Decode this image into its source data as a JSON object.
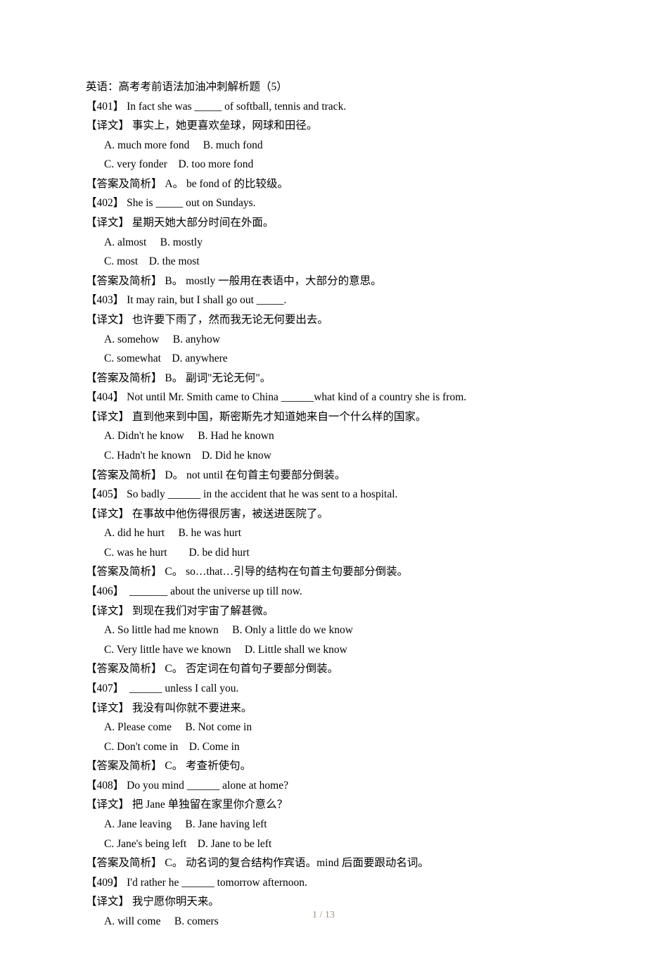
{
  "title": "英语：高考考前语法加油冲刺解析题（5）",
  "footer": "1 / 13",
  "questions": [
    {
      "num": "【401】",
      "stem": " In fact she was _____ of softball, tennis and track.",
      "trans": "【译文】 事实上，她更喜欢垒球，网球和田径。",
      "opts": [
        "A. much more fond     B. much fond",
        "C. very fonder    D. too more fond"
      ],
      "ans": "【答案及简析】 A。 be fond of 的比较级。"
    },
    {
      "num": "【402】",
      "stem": " She is _____ out on Sundays.",
      "trans": "【译文】 星期天她大部分时间在外面。",
      "opts": [
        "A. almost     B. mostly",
        "C. most    D. the most"
      ],
      "ans": "【答案及简析】 B。 mostly 一般用在表语中，大部分的意思。"
    },
    {
      "num": "【403】",
      "stem": " It may rain, but I shall go out _____.",
      "trans": "【译文】 也许要下雨了，然而我无论无何要出去。",
      "opts": [
        "A. somehow     B. anyhow",
        "C. somewhat    D. anywhere"
      ],
      "ans": "【答案及简析】 B。 副词\"无论无何\"。"
    },
    {
      "num": "【404】",
      "stem": " Not until Mr. Smith came to China ______what kind of a country she is from.",
      "trans": "【译文】 直到他来到中国，斯密斯先才知道她来自一个什么样的国家。",
      "opts": [
        "A. Didn't he know     B. Had he known",
        "C. Hadn't he known    D. Did he know"
      ],
      "ans": "【答案及简析】 D。 not until 在句首主句要部分倒装。"
    },
    {
      "num": "【405】",
      "stem": " So badly ______ in the accident that he was sent to a hospital.",
      "trans": "【译文】 在事故中他伤得很厉害，被送进医院了。",
      "opts": [
        "A. did he hurt     B. he was hurt",
        "C. was he hurt        D. be did hurt"
      ],
      "ans": "【答案及简析】 C。 so…that…引导的结构在句首主句要部分倒装。"
    },
    {
      "num": "【406】",
      "stem": "  _______ about the universe up till now.",
      "trans": "【译文】 到现在我们对宇宙了解甚微。",
      "opts": [
        "A. So little had me known     B. Only a little do we know",
        "C. Very little have we known     D. Little shall we know"
      ],
      "ans": "【答案及简析】 C。 否定词在句首句子要部分倒装。"
    },
    {
      "num": "【407】",
      "stem": "  ______ unless I call you.",
      "trans": "【译文】 我没有叫你就不要进来。",
      "opts": [
        "A. Please come     B. Not come in",
        "C. Don't come in    D. Come in"
      ],
      "ans": "【答案及简析】 C。 考查祈使句。"
    },
    {
      "num": "【408】",
      "stem": " Do you mind ______ alone at home?",
      "trans": "【译文】 把 Jane 单独留在家里你介意么？",
      "opts": [
        "A. Jane leaving     B. Jane having left",
        "C. Jane's being left    D. Jane to be left"
      ],
      "ans": "【答案及简析】 C。 动名词的复合结构作宾语。mind 后面要跟动名词。"
    },
    {
      "num": "【409】",
      "stem": " I'd rather he ______ tomorrow afternoon.",
      "trans": "【译文】 我宁愿你明天来。",
      "opts": [
        "A. will come     B. comers"
      ],
      "ans": null
    }
  ]
}
